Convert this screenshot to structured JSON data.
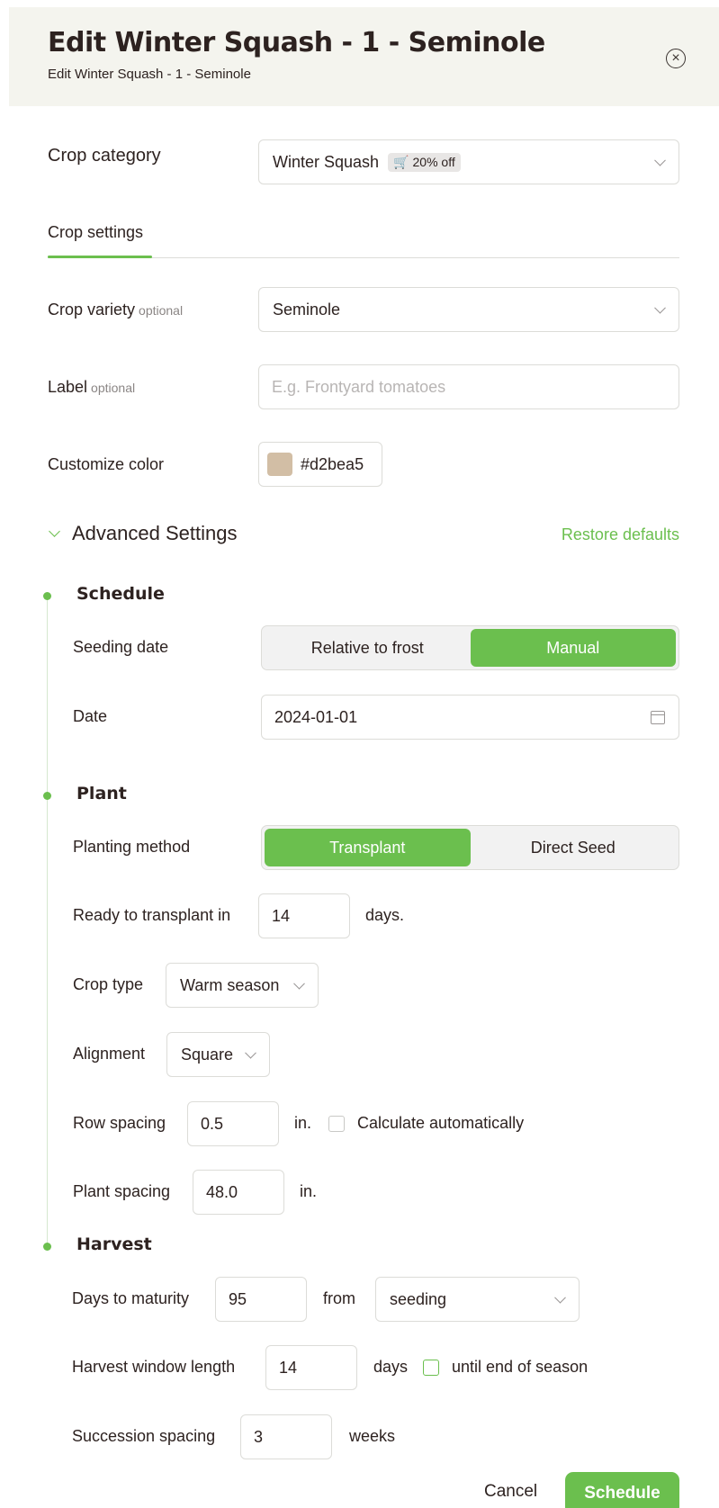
{
  "header": {
    "title": "Edit Winter Squash - 1 - Seminole",
    "subtitle": "Edit Winter Squash - 1 - Seminole"
  },
  "crop_category": {
    "label": "Crop category",
    "value": "Winter Squash",
    "badge": "20% off",
    "badge_icon": "cart-icon"
  },
  "tabs": [
    {
      "label": "Crop settings",
      "active": true
    }
  ],
  "crop_variety": {
    "label": "Crop variety",
    "optional": "optional",
    "value": "Seminole"
  },
  "label_field": {
    "label": "Label",
    "optional": "optional",
    "value": "",
    "placeholder": "E.g. Frontyard tomatoes"
  },
  "customize_color": {
    "label": "Customize color",
    "value": "#d2bea5"
  },
  "advanced": {
    "title": "Advanced Settings",
    "restore": "Restore defaults"
  },
  "schedule": {
    "title": "Schedule",
    "seeding_date_label": "Seeding date",
    "seeding_options": [
      "Relative to frost",
      "Manual"
    ],
    "seeding_selected": "Manual",
    "date_label": "Date",
    "date_value": "2024-01-01"
  },
  "plant": {
    "title": "Plant",
    "planting_method_label": "Planting method",
    "planting_options": [
      "Transplant",
      "Direct Seed"
    ],
    "planting_selected": "Transplant",
    "ready_label": "Ready to transplant in",
    "ready_value": "14",
    "ready_unit": "days.",
    "crop_type_label": "Crop type",
    "crop_type_value": "Warm season",
    "alignment_label": "Alignment",
    "alignment_value": "Square",
    "row_spacing_label": "Row spacing",
    "row_spacing_value": "0.5",
    "row_spacing_unit": "in.",
    "calc_auto_label": "Calculate automatically",
    "plant_spacing_label": "Plant spacing",
    "plant_spacing_value": "48.0",
    "plant_spacing_unit": "in."
  },
  "harvest": {
    "title": "Harvest",
    "dtm_label": "Days to maturity",
    "dtm_value": "95",
    "dtm_from": "from",
    "dtm_from_value": "seeding",
    "window_label": "Harvest window length",
    "window_value": "14",
    "window_unit": "days",
    "until_end_label": "until end of season",
    "succession_label": "Succession spacing",
    "succession_value": "3",
    "succession_unit": "weeks"
  },
  "footer": {
    "cancel": "Cancel",
    "schedule": "Schedule"
  },
  "colors": {
    "accent": "#6bbf4e",
    "header_bg": "#f4f4ee",
    "swatch": "#d2bea5"
  }
}
